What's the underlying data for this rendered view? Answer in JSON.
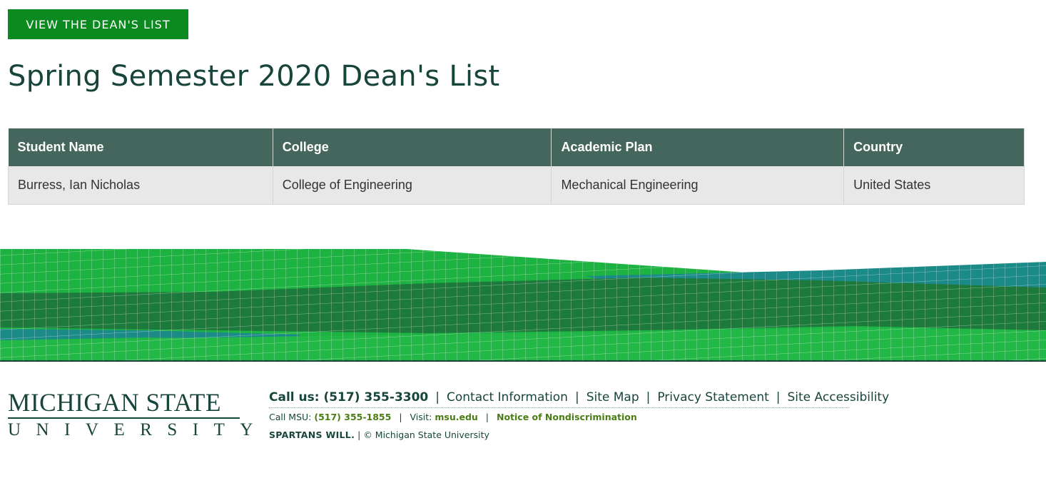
{
  "header": {
    "view_button_label": "VIEW THE DEAN'S LIST",
    "page_title": "Spring Semester 2020 Dean's List"
  },
  "table": {
    "columns": [
      "Student Name",
      "College",
      "Academic Plan",
      "Country"
    ],
    "rows": [
      [
        "Burress, Ian Nicholas",
        "College of Engineering",
        "Mechanical Engineering",
        "United States"
      ]
    ]
  },
  "footer": {
    "logo_line1": "MICHIGAN STATE",
    "logo_line2": "UNIVERSITY",
    "call_us": "Call us: (517) 355-3300",
    "links": [
      "Contact Information",
      "Site Map",
      "Privacy Statement",
      "Site Accessibility"
    ],
    "call_msu_label": "Call MSU:",
    "call_msu_number": "(517) 355-1855",
    "visit_label": "Visit:",
    "visit_link": "msu.edu",
    "nondiscrimination": "Notice of Nondiscrimination",
    "spartans_will": "SPARTANS WILL.",
    "copyright": "© Michigan State University"
  },
  "colors": {
    "msu_green": "#18453b",
    "button_green": "#0b8a1f",
    "table_header": "#45665c",
    "table_row": "#e8e8e8",
    "link_green": "#4a7c14",
    "wave_bright": "#1db342",
    "wave_dark": "#1e7a3c",
    "wave_teal": "#1d8a8a"
  }
}
